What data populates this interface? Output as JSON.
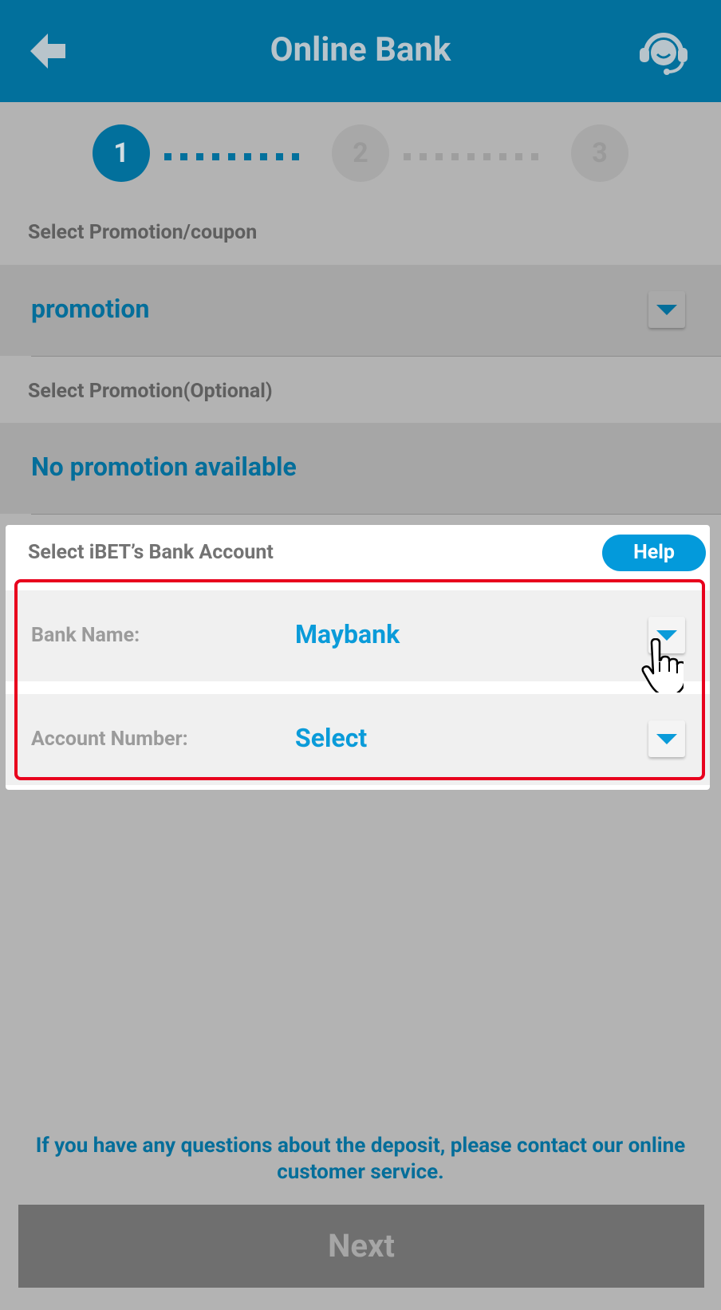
{
  "header": {
    "title": "Online Bank",
    "back_icon": "back-arrow-icon",
    "support_icon": "customer-service-icon"
  },
  "steps": [
    {
      "number": "1",
      "state": "active"
    },
    {
      "number": "2",
      "state": "inactive"
    },
    {
      "number": "3",
      "state": "inactive"
    }
  ],
  "promotion_coupon": {
    "label": "Select Promotion/coupon",
    "value": "promotion"
  },
  "promotion_optional": {
    "label": "Select Promotion(Optional)",
    "value": "No promotion available"
  },
  "bank_account": {
    "title": "Select iBET’s Bank Account",
    "help_label": "Help",
    "bank_name_label": "Bank Name:",
    "bank_name_value": "Maybank",
    "account_number_label": "Account Number:",
    "account_number_value": "Select"
  },
  "footer": {
    "note": "If you have any questions about the deposit, please contact our online customer service.",
    "next_label": "Next"
  },
  "colors": {
    "header_bg": "#02709c",
    "accent_blue": "#039adb",
    "highlight_red": "#e8001d",
    "overlay_gray": "#b3b3b3"
  }
}
